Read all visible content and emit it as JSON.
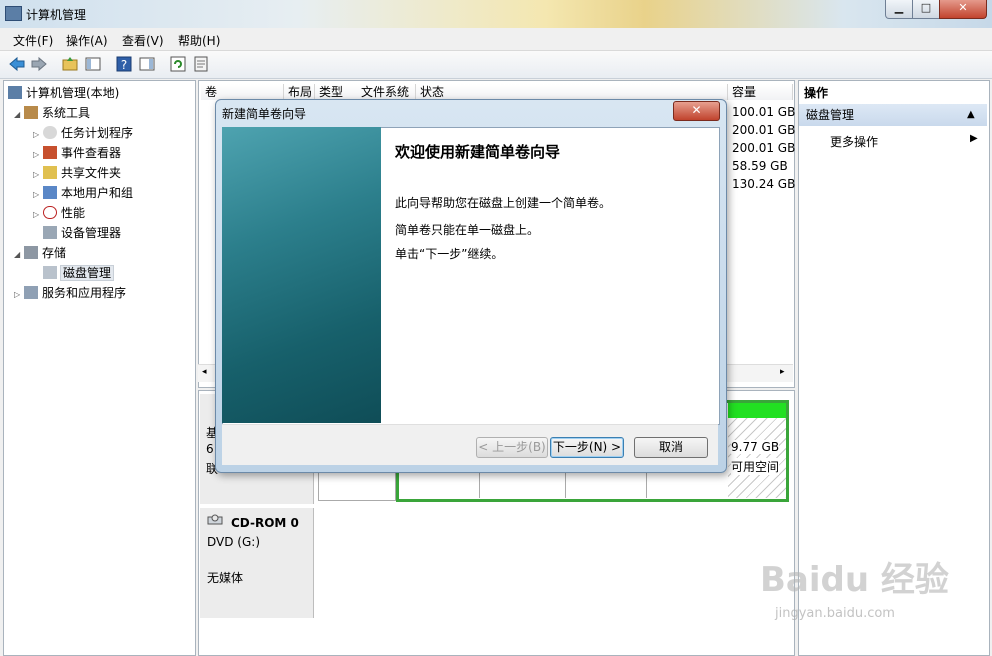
{
  "window": {
    "title": "计算机管理",
    "min": "▁",
    "max": "□",
    "close": "✕"
  },
  "menu": [
    "文件(F)",
    "操作(A)",
    "查看(V)",
    "帮助(H)"
  ],
  "tree": {
    "root": "计算机管理(本地)",
    "system_tools": "系统工具",
    "task_scheduler": "任务计划程序",
    "event_viewer": "事件查看器",
    "shared_folders": "共享文件夹",
    "local_users": "本地用户和组",
    "performance": "性能",
    "device_manager": "设备管理器",
    "storage": "存储",
    "disk_management": "磁盘管理",
    "services_apps": "服务和应用程序"
  },
  "columns": [
    "卷",
    "布局",
    "类型",
    "文件系统",
    "状态",
    "容量"
  ],
  "capacities": [
    "100.01 GB",
    "200.01 GB",
    "200.01 GB",
    "58.59 GB",
    "130.24 GB"
  ],
  "disk0": {
    "label": "基",
    "line2": "6",
    "line3": "联",
    "free_size": "9.77 GB",
    "free_text": "可用空间"
  },
  "cdrom": {
    "name": "CD-ROM 0",
    "drive": "DVD (G:)",
    "status": "无媒体"
  },
  "actions": {
    "header": "操作",
    "selected": "磁盘管理",
    "more": "更多操作"
  },
  "dialog": {
    "title": "新建简单卷向导",
    "close": "✕",
    "heading": "欢迎使用新建简单卷向导",
    "p1": "此向导帮助您在磁盘上创建一个简单卷。",
    "p2": "简单卷只能在单一磁盘上。",
    "p3": "单击“下一步”继续。",
    "back": "< 上一步(B)",
    "next": "下一步(N) >",
    "cancel": "取消"
  },
  "watermark": {
    "logo": "Baidu 经验",
    "url": "jingyan.baidu.com"
  },
  "colors": {
    "accent_green": "#22e022",
    "dialog_side": "#17606b"
  }
}
